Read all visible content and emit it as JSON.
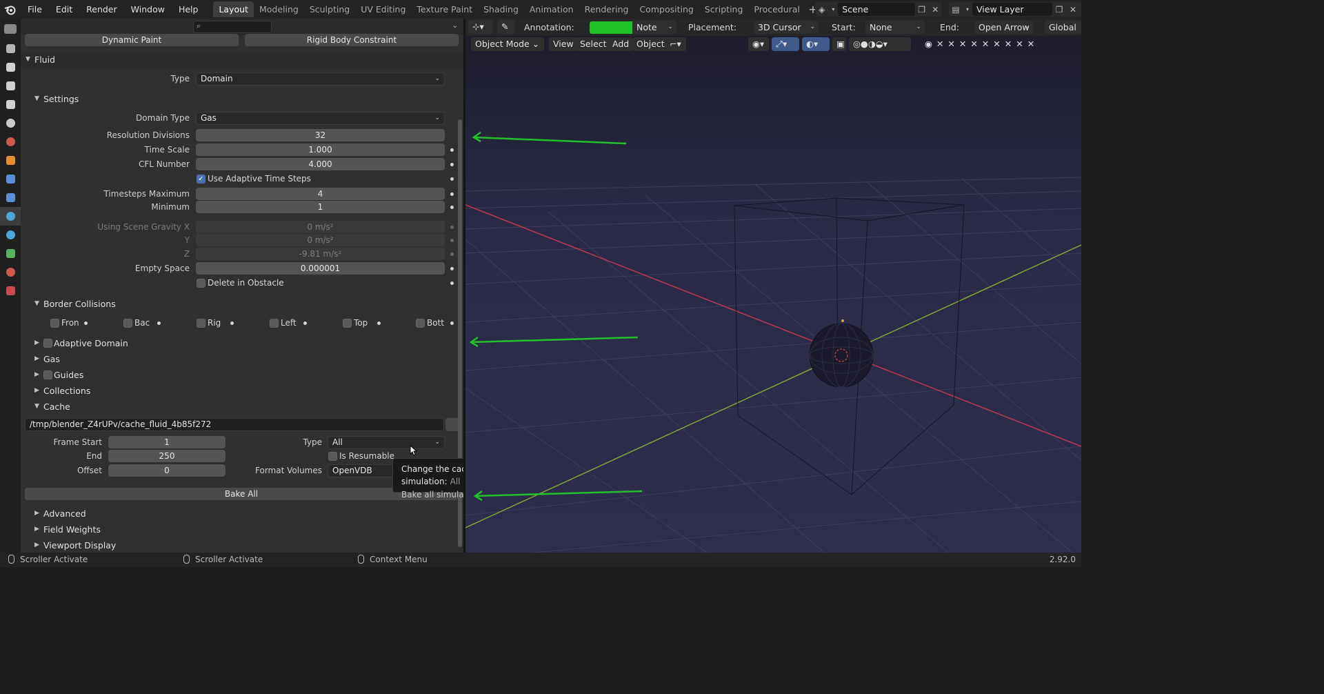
{
  "menubar": {
    "items": [
      "File",
      "Edit",
      "Render",
      "Window",
      "Help"
    ]
  },
  "workspaces": {
    "tabs": [
      "Layout",
      "Modeling",
      "Sculpting",
      "UV Editing",
      "Texture Paint",
      "Shading",
      "Animation",
      "Rendering",
      "Compositing",
      "Scripting",
      "Procedural"
    ],
    "active": "Layout"
  },
  "scene": {
    "name": "Scene"
  },
  "view_layer": {
    "name": "View Layer"
  },
  "properties": {
    "top_buttons": {
      "dynamic_paint": "Dynamic Paint",
      "rigid_body_constraint": "Rigid Body Constraint"
    },
    "fluid": {
      "title": "Fluid",
      "type_label": "Type",
      "type_value": "Domain",
      "settings": {
        "title": "Settings",
        "domain_type_label": "Domain Type",
        "domain_type_value": "Gas",
        "resolution_label": "Resolution Divisions",
        "resolution_value": "32",
        "time_scale_label": "Time Scale",
        "time_scale_value": "1.000",
        "cfl_label": "CFL Number",
        "cfl_value": "4.000",
        "adaptive_label": "Use Adaptive Time Steps",
        "timesteps_max_label": "Timesteps Maximum",
        "timesteps_max_value": "4",
        "min_label": "Minimum",
        "min_value": "1",
        "gravity_x_label": "Using Scene Gravity X",
        "gravity_x_value": "0 m/s²",
        "gravity_y_label": "Y",
        "gravity_y_value": "0 m/s²",
        "gravity_z_label": "Z",
        "gravity_z_value": "-9.81 m/s²",
        "empty_space_label": "Empty Space",
        "empty_space_value": "0.000001",
        "delete_obstacle_label": "Delete in Obstacle"
      },
      "border_collisions": {
        "title": "Border Collisions",
        "items": [
          "Fron",
          "Bac",
          "Rig",
          "Left",
          "Top",
          "Bott"
        ]
      },
      "subpanels": {
        "adaptive_domain": "Adaptive Domain",
        "gas": "Gas",
        "guides": "Guides",
        "collections": "Collections",
        "cache": "Cache"
      },
      "cache": {
        "path": "/tmp/blender_Z4rUPv/cache_fluid_4b85f272",
        "frame_start_label": "Frame Start",
        "frame_start_value": "1",
        "end_label": "End",
        "end_value": "250",
        "offset_label": "Offset",
        "offset_value": "0",
        "type_label": "Type",
        "type_value": "All",
        "resumable_label": "Is Resumable",
        "format_label": "Format Volumes",
        "format_value": "OpenVDB",
        "bake_all": "Bake All"
      },
      "bottom_panels": {
        "advanced": "Advanced",
        "field_weights": "Field Weights",
        "viewport_display": "Viewport Display"
      }
    }
  },
  "viewport": {
    "annotation_label": "Annotation:",
    "annotation_color": "#22c22b",
    "note_value": "Note",
    "placement_label": "Placement:",
    "placement_value": "3D Cursor",
    "start_label": "Start:",
    "start_value": "None",
    "end_label": "End:",
    "end_value": "Open Arrow",
    "global_value": "Global",
    "mode_value": "Object Mode",
    "menu": [
      "View",
      "Select",
      "Add",
      "Object"
    ]
  },
  "tooltip": {
    "title": "Change the cache type of the simulation:",
    "value": "All",
    "description": "Bake all simulation settings at once"
  },
  "statusbar": {
    "item1": "Scroller Activate",
    "item2": "Scroller Activate",
    "item3": "Context Menu",
    "version": "2.92.0"
  },
  "colors": {
    "accent": "#4772b3",
    "annotation_green": "#22c22b",
    "x_axis": "#c0384c",
    "y_axis": "#7fa832"
  }
}
